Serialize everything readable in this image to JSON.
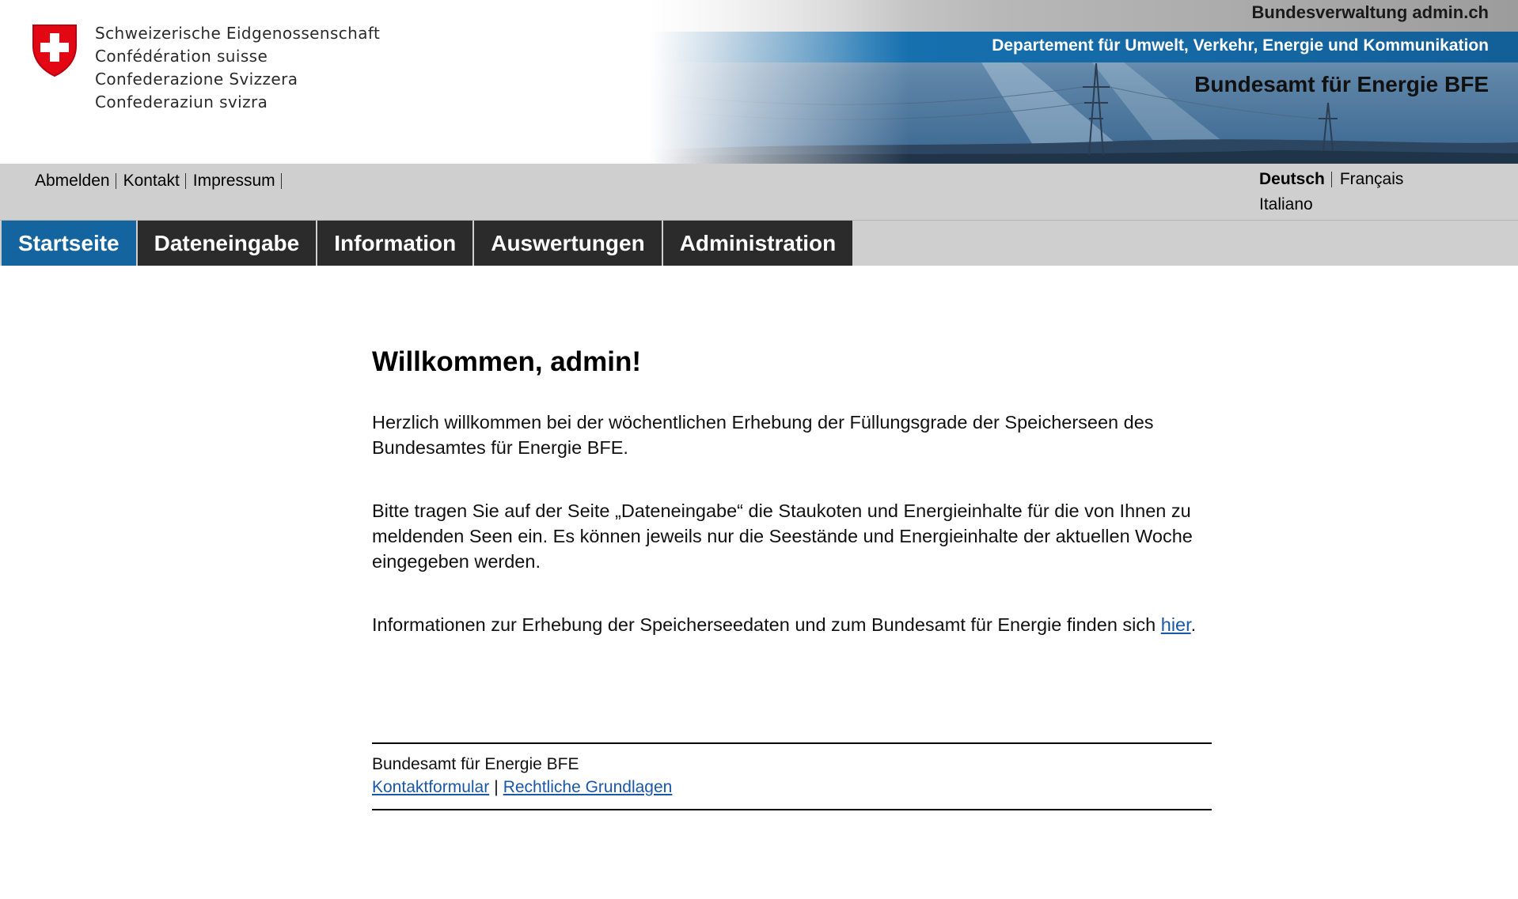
{
  "header": {
    "confederation_names": [
      "Schweizerische Eidgenossenschaft",
      "Confédération suisse",
      "Confederazione Svizzera",
      "Confederaziun svizra"
    ],
    "admin_link": "Bundesverwaltung admin.ch",
    "department": "Departement für Umwelt, Verkehr, Energie und Kommunikation",
    "office": "Bundesamt für Energie BFE",
    "logo_icon": "swiss-cross-shield-icon",
    "colors": {
      "shield_red": "#e30613",
      "department_bar": "#1671b0"
    }
  },
  "metabar": {
    "links": [
      "Abmelden",
      "Kontakt",
      "Impressum"
    ],
    "languages": {
      "active": "Deutsch",
      "others": [
        "Français",
        "Italiano"
      ]
    }
  },
  "nav": {
    "tabs": [
      "Startseite",
      "Dateneingabe",
      "Information",
      "Auswertungen",
      "Administration"
    ],
    "active_tab": "Startseite",
    "colors": {
      "active": "#14659f",
      "inactive": "#2b2b2b"
    }
  },
  "main": {
    "title": "Willkommen, admin!",
    "paragraph1": "Herzlich willkommen bei der wöchentlichen Erhebung der Füllungsgrade der Speicherseen des Bundesamtes für Energie BFE.",
    "paragraph2": "Bitte tragen Sie auf der Seite „Dateneingabe“ die Staukoten und Energieinhalte für die von Ihnen zu meldenden Seen ein. Es können jeweils nur die Seestände und Energieinhalte der aktuellen Woche eingegeben werden.",
    "paragraph3": "Informationen zur Erhebung der Speicherseedaten und zum Bundesamt für Energie finden sich",
    "paragraph3_link": "hier",
    "paragraph3_end": "."
  },
  "footer": {
    "org": "Bundesamt für Energie BFE",
    "links": [
      "Kontaktformular",
      "Rechtliche Grundlagen"
    ],
    "separator": "|"
  }
}
